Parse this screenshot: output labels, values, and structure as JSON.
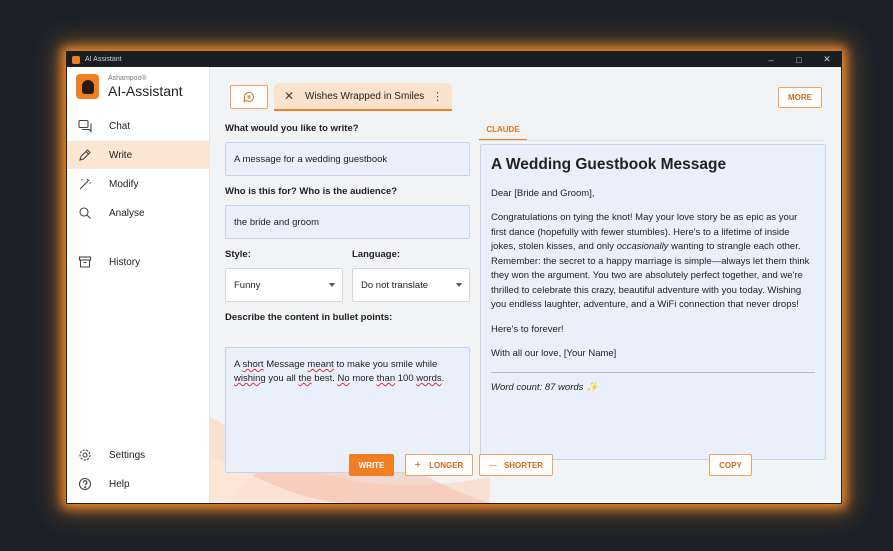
{
  "window": {
    "title": "AI Assistant",
    "controls": [
      "–",
      "□",
      "✕"
    ]
  },
  "brand": {
    "small": "Ashampoo®",
    "name": "AI-Assistant",
    "accent": "#f07f23"
  },
  "nav": {
    "top": [
      {
        "label": "Chat",
        "icon": "chat-icon",
        "active": false
      },
      {
        "label": "Write",
        "icon": "pen-icon",
        "active": true
      },
      {
        "label": "Modify",
        "icon": "magic-wand-icon",
        "active": false
      },
      {
        "label": "Analyse",
        "icon": "search-icon",
        "active": false
      },
      {
        "label": "History",
        "icon": "archive-box-icon",
        "active": false
      }
    ],
    "bottom": [
      {
        "label": "Settings",
        "icon": "gear-icon"
      },
      {
        "label": "Help",
        "icon": "help-circle-icon"
      }
    ]
  },
  "tabs": {
    "new_icon": "chat-plus-icon",
    "active_label": "Wishes Wrapped in Smiles",
    "close_glyph": "✕",
    "menu_glyph": "⋮",
    "more_label": "MORE"
  },
  "form": {
    "what_label": "What would you like to write?",
    "what_value": "A message for a wedding guestbook",
    "audience_label": "Who is this for? Who is the audience?",
    "audience_value": "the bride and groom",
    "style_label": "Style:",
    "style_value": "Funny",
    "language_label": "Language:",
    "language_value": "Do not translate",
    "bullets_label": "Describe the content in bullet points:",
    "bullets_value": {
      "s1": "A ",
      "s2": "short",
      "s3": " Message ",
      "s4": "meant",
      "s5": " to make you smile while ",
      "s6": "wishing",
      "s7": " you all ",
      "s8": "the",
      "s9": " best. ",
      "s10": "No",
      "s11": " more ",
      "s12": "than",
      "s13": " 100 ",
      "s14": "words",
      "s15": "."
    }
  },
  "output": {
    "provider_tab": "CLAUDE",
    "heading": "A Wedding Guestbook Message",
    "greeting": "Dear [Bride and Groom],",
    "body_before": "Congratulations on tying the knot! May your love story be as epic as your first dance (hopefully with fewer stumbles). Here's to a lifetime of inside jokes, stolen kisses, and only ",
    "body_em": "occasionally",
    "body_after": " wanting to strangle each other. Remember: the secret to a happy marriage is simple—always let them think they won the argument. You two are absolutely perfect together, and we're thrilled to celebrate this crazy, beautiful adventure with you today. Wishing you endless laughter, adventure, and a WiFi connection that never drops!",
    "closing": "Here's to forever!",
    "signoff": "With all our love, [Your Name]",
    "word_count": "Word count: 87 words",
    "sparkle": "✨"
  },
  "actions": {
    "write": "WRITE",
    "longer": "LONGER",
    "longer_icon": "+",
    "shorter": "SHORTER",
    "shorter_icon": "—",
    "copy": "COPY"
  }
}
